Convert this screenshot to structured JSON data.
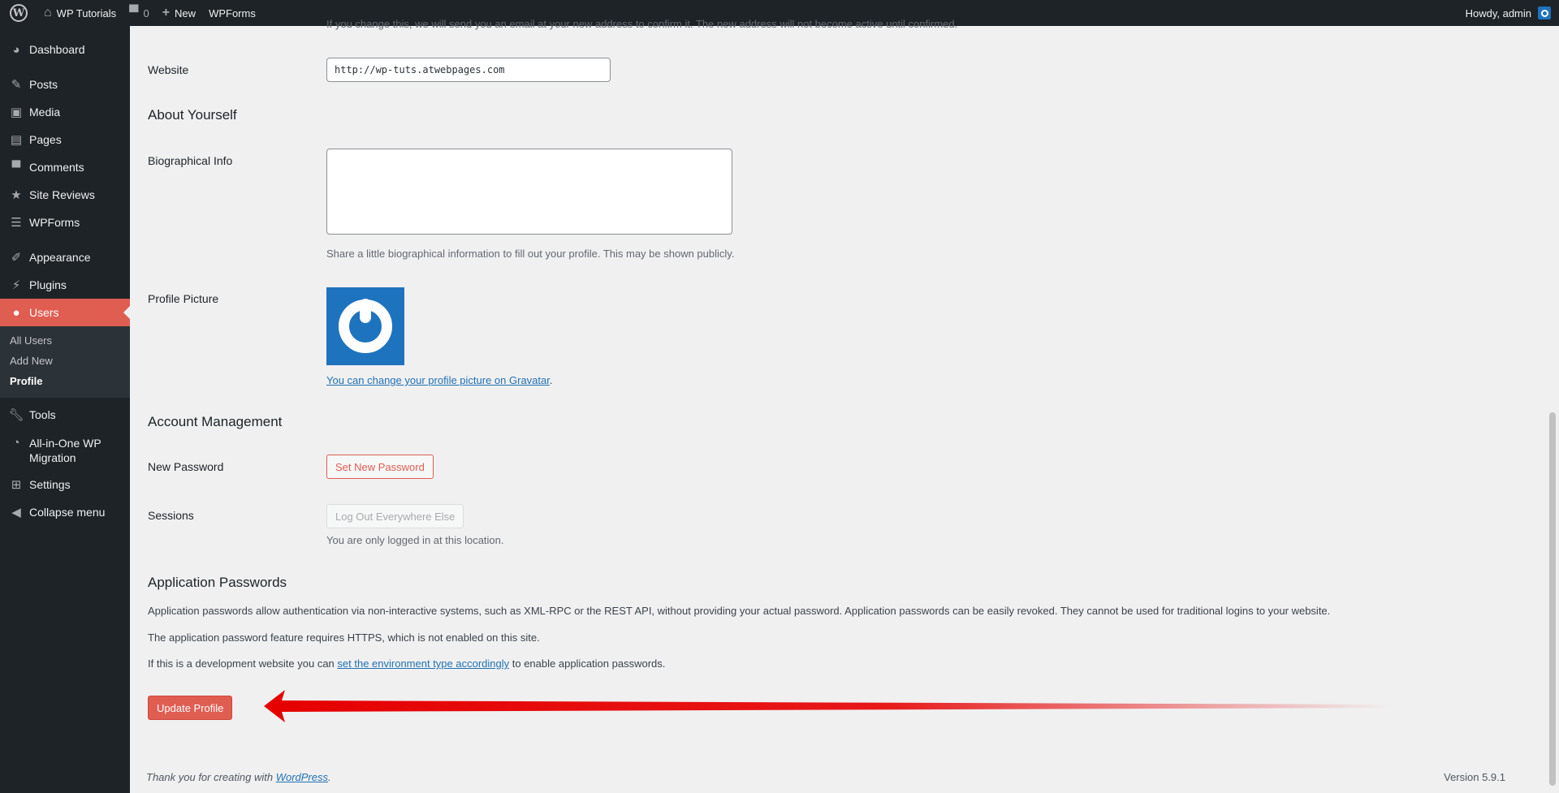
{
  "adminbar": {
    "site_name": "WP Tutorials",
    "comments_count": "0",
    "new_label": "New",
    "wpforms_label": "WPForms",
    "greeting": "Howdy, admin"
  },
  "sidebar": {
    "items": [
      {
        "label": "Dashboard",
        "icon": "dashboard-icon"
      },
      {
        "label": "Posts",
        "icon": "pin-icon"
      },
      {
        "label": "Media",
        "icon": "media-icon"
      },
      {
        "label": "Pages",
        "icon": "pages-icon"
      },
      {
        "label": "Comments",
        "icon": "comment-icon"
      },
      {
        "label": "Site Reviews",
        "icon": "star-icon"
      },
      {
        "label": "WPForms",
        "icon": "form-icon"
      },
      {
        "label": "Appearance",
        "icon": "brush-icon"
      },
      {
        "label": "Plugins",
        "icon": "plug-icon"
      },
      {
        "label": "Users",
        "icon": "user-icon"
      },
      {
        "label": "Tools",
        "icon": "wrench-icon"
      },
      {
        "label": "All-in-One WP Migration",
        "icon": "migration-icon"
      },
      {
        "label": "Settings",
        "icon": "settings-icon"
      },
      {
        "label": "Collapse menu",
        "icon": "collapse-icon"
      }
    ],
    "users_submenu": [
      "All Users",
      "Add New",
      "Profile"
    ]
  },
  "form": {
    "email_note": "If you change this, we will send you an email at your new address to confirm it. The new address will not become active until confirmed.",
    "website_label": "Website",
    "website_value": "http://wp-tuts.atwebpages.com",
    "about_title": "About Yourself",
    "bio_label": "Biographical Info",
    "bio_value": "",
    "bio_desc": "Share a little biographical information to fill out your profile. This may be shown publicly.",
    "picture_label": "Profile Picture",
    "gravatar_link": "You can change your profile picture on Gravatar",
    "account_title": "Account Management",
    "new_password_label": "New Password",
    "set_password_button": "Set New Password",
    "sessions_label": "Sessions",
    "logout_button": "Log Out Everywhere Else",
    "sessions_desc": "You are only logged in at this location.",
    "app_passwords_title": "Application Passwords",
    "app_para1": "Application passwords allow authentication via non-interactive systems, such as XML-RPC or the REST API, without providing your actual password. Application passwords can be easily revoked. They cannot be used for traditional logins to your website.",
    "app_para2": "The application password feature requires HTTPS, which is not enabled on this site.",
    "app_para3_prefix": "If this is a development website you can ",
    "app_para3_link": "set the environment type accordingly",
    "app_para3_suffix": " to enable application passwords.",
    "update_button": "Update Profile"
  },
  "footer": {
    "thanks_prefix": "Thank you for creating with ",
    "thanks_link": "WordPress",
    "thanks_suffix": ".",
    "version": "Version 5.9.1"
  },
  "colors": {
    "accent": "#e05d52",
    "sidebar_bg": "#1d2327",
    "arrow": "#e60000"
  }
}
